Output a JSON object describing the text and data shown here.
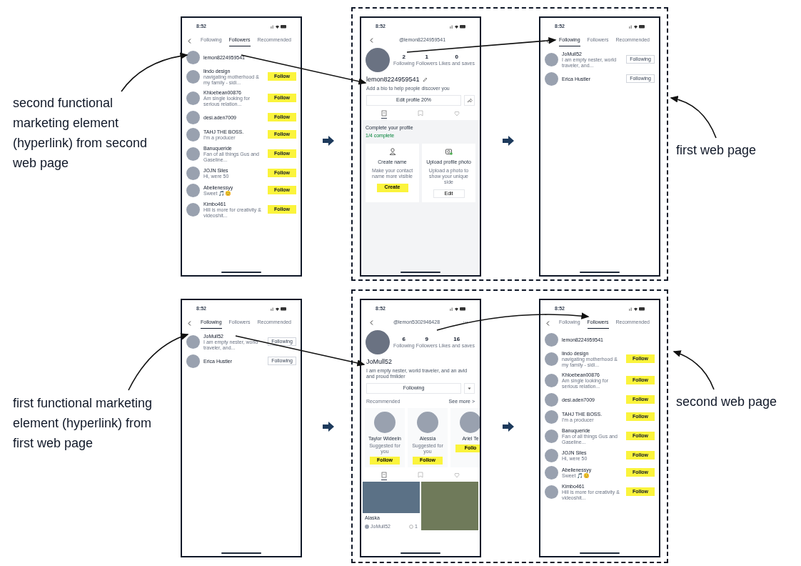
{
  "rows": [
    {
      "left_label": "second functional marketing element (hyperlink) from second web page",
      "right_label": "first web page",
      "grouped": true,
      "screens": [
        {
          "kind": "list",
          "time": "8:52",
          "tabs": [
            {
              "label": "Following",
              "selected": false
            },
            {
              "label": "Followers",
              "selected": true
            },
            {
              "label": "Recommended",
              "selected": false
            }
          ],
          "items": [
            {
              "name": "lemon8224959541"
            },
            {
              "name": "lindo design",
              "sub": "navigating motherhood & my family - sidi...",
              "button": "Follow",
              "following": false
            },
            {
              "name": "Khloebean00876",
              "sub": "Am single looking for serious relation...",
              "button": "Follow",
              "following": false
            },
            {
              "name": "desi.aden7009",
              "button": "Follow",
              "following": false
            },
            {
              "name": "TAHJ THE BOSS.",
              "sub": "I'm a producer",
              "button": "Follow",
              "following": false
            },
            {
              "name": "Banuqueride",
              "sub": "Fan of all things Gus and Gaseline...",
              "button": "Follow",
              "following": false
            },
            {
              "name": "JOJN Siles",
              "sub": "Hi, were 50",
              "button": "Follow",
              "following": false
            },
            {
              "name": "Abelienessyy",
              "sub": "Sweet 🎵😊",
              "button": "Follow",
              "following": false
            },
            {
              "name": "Kimbo461",
              "sub": "Hill is more for creativity & videoshit...",
              "button": "Follow",
              "following": false
            }
          ]
        },
        {
          "kind": "profile",
          "time": "8:52",
          "handle": "@lemon8224959541",
          "stats": [
            {
              "value": "2",
              "label": "Following"
            },
            {
              "value": "1",
              "label": "Followers"
            },
            {
              "value": "0",
              "label": "Likes and saves"
            }
          ],
          "name": "lemon8224959541",
          "editable": true,
          "bio": "Add a bio to help people discover you",
          "action": {
            "label": "Edit profile 20%",
            "kind": "share"
          },
          "content_tabs": [
            {
              "kind": "grid",
              "selected": true
            },
            {
              "kind": "bookmark",
              "selected": false
            },
            {
              "kind": "heart",
              "selected": false
            }
          ],
          "complete": {
            "title": "Complete your profile",
            "progress": "1/4 complete",
            "cards": [
              {
                "title": "Create name",
                "desc": "Make your contact name more visible",
                "button": "Create",
                "primary": true
              },
              {
                "title": "Upload profile photo",
                "desc": "Upload a photo to show your unique side",
                "button": "Edit",
                "primary": false
              }
            ]
          }
        },
        {
          "kind": "list",
          "time": "8:52",
          "tabs": [
            {
              "label": "Following",
              "selected": true
            },
            {
              "label": "Followers",
              "selected": false
            },
            {
              "label": "Recommended",
              "selected": false
            }
          ],
          "items": [
            {
              "name": "JoMull52",
              "sub": "I am empty nester, world traveler, and...",
              "button": "Following",
              "following": true
            },
            {
              "name": "Erica Hustler",
              "button": "Following",
              "following": true
            }
          ]
        }
      ]
    },
    {
      "left_label": "first functional marketing element (hyperlink) from first web page",
      "right_label": "second web page",
      "grouped": true,
      "screens": [
        {
          "kind": "list",
          "time": "8:52",
          "tabs": [
            {
              "label": "Following",
              "selected": true
            },
            {
              "label": "Followers",
              "selected": false
            },
            {
              "label": "Recommended",
              "selected": false
            }
          ],
          "items": [
            {
              "name": "JoMull52",
              "sub": "I am empty nester, world traveler, and...",
              "button": "Following",
              "following": true
            },
            {
              "name": "Erica Hustler",
              "button": "Following",
              "following": true
            }
          ]
        },
        {
          "kind": "profile",
          "time": "8:52",
          "handle": "@lemon5302946428",
          "more": "···",
          "stats": [
            {
              "value": "6",
              "label": "Following"
            },
            {
              "value": "9",
              "label": "Followers"
            },
            {
              "value": "16",
              "label": "Likes and saves"
            }
          ],
          "name": "JoMull52",
          "editable": false,
          "bio": "I am empty nester, world traveler, and an avid and proud fmlider",
          "action": {
            "label": "Following",
            "kind": "dropdown"
          },
          "recommended": {
            "title": "Recommended",
            "more": "See more >",
            "cards": [
              {
                "name": "Taylor Wideeln",
                "sub": "Suggested for you",
                "button": "Follow"
              },
              {
                "name": "Alessia",
                "sub": "Suggested for you",
                "button": "Follow"
              },
              {
                "name": "Ariel Te",
                "button": "Follo"
              }
            ]
          },
          "content_tabs": [
            {
              "kind": "grid",
              "selected": true
            },
            {
              "kind": "bookmark",
              "selected": false
            },
            {
              "kind": "heart",
              "selected": false
            }
          ],
          "posts": [
            {
              "kind": "captioned",
              "caption": "Alaska",
              "user": "JoMull52",
              "likes": "1"
            },
            {
              "kind": "video"
            }
          ]
        },
        {
          "kind": "list",
          "time": "8:52",
          "tabs": [
            {
              "label": "Following",
              "selected": false
            },
            {
              "label": "Followers",
              "selected": true
            },
            {
              "label": "Recommended",
              "selected": false
            }
          ],
          "items": [
            {
              "name": "lemon8224959541"
            },
            {
              "name": "lindo design",
              "sub": "navigating motherhood & my family - sidi...",
              "button": "Follow",
              "following": false
            },
            {
              "name": "Khloebean00876",
              "sub": "Am single looking for serious relation...",
              "button": "Follow",
              "following": false
            },
            {
              "name": "desi.aden7009",
              "button": "Follow",
              "following": false
            },
            {
              "name": "TAHJ THE BOSS.",
              "sub": "I'm a producer",
              "button": "Follow",
              "following": false
            },
            {
              "name": "Banuqueride",
              "sub": "Fan of all things Gus and Gaseline...",
              "button": "Follow",
              "following": false
            },
            {
              "name": "JOJN Siles",
              "sub": "Hi, were 50",
              "button": "Follow",
              "following": false
            },
            {
              "name": "Abelienessyy",
              "sub": "Sweet 🎵😊",
              "button": "Follow",
              "following": false
            },
            {
              "name": "Kimbo461",
              "sub": "Hill is more for creativity & videoshit...",
              "button": "Follow",
              "following": false
            }
          ]
        }
      ]
    }
  ]
}
